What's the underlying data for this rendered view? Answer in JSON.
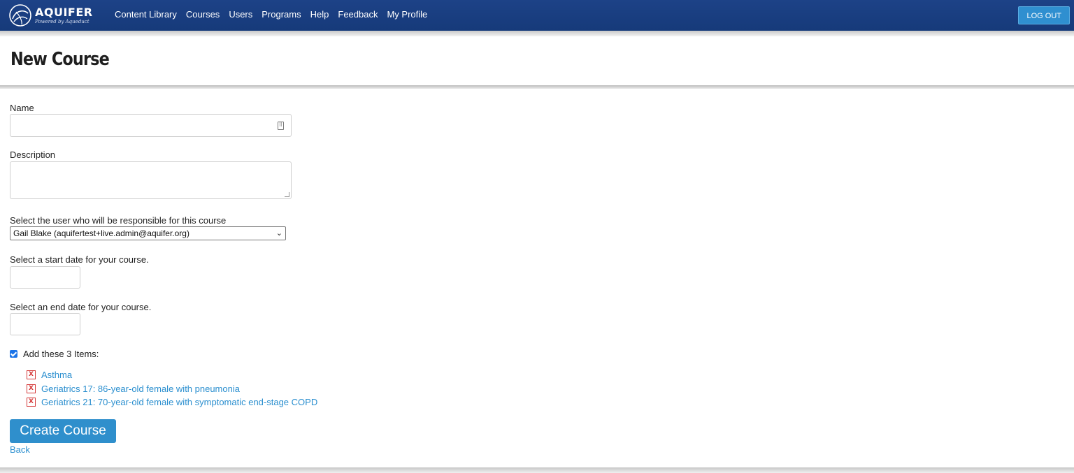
{
  "header": {
    "logo": {
      "main": "AQUIFER",
      "sub": "Powered by Aqueduct"
    },
    "nav": [
      "Content Library",
      "Courses",
      "Users",
      "Programs",
      "Help",
      "Feedback",
      "My Profile"
    ],
    "logout_label": "LOG OUT",
    "colors": {
      "bar": "#1d4287",
      "button": "#2f8fd0"
    }
  },
  "page": {
    "title": "New Course"
  },
  "form": {
    "name_label": "Name",
    "name_value": "",
    "description_label": "Description",
    "description_value": "",
    "owner_label": "Select the user who will be responsible for this course",
    "owner_selected": "Gail Blake (aquifertest+live.admin@aquifer.org)",
    "start_label": "Select a start date for your course.",
    "start_value": "",
    "end_label": "Select an end date for your course.",
    "end_value": "",
    "add_items_label": "Add these 3 Items:",
    "add_items_checked": true,
    "items": [
      "Asthma",
      "Geriatrics 17: 86-year-old female with pneumonia",
      "Geriatrics 21: 70-year-old female with symptomatic end-stage COPD"
    ],
    "remove_symbol": "X",
    "submit_label": "Create Course",
    "back_label": "Back"
  },
  "icons": {
    "logo": "aquifer-swirl-icon",
    "name_field": "keyboard-icon",
    "select": "chevron-down-icon",
    "remove": "remove-x-icon"
  },
  "colors": {
    "link": "#2b8fcf",
    "primary_button": "#2f8fcc",
    "remove": "#d43a3a"
  }
}
